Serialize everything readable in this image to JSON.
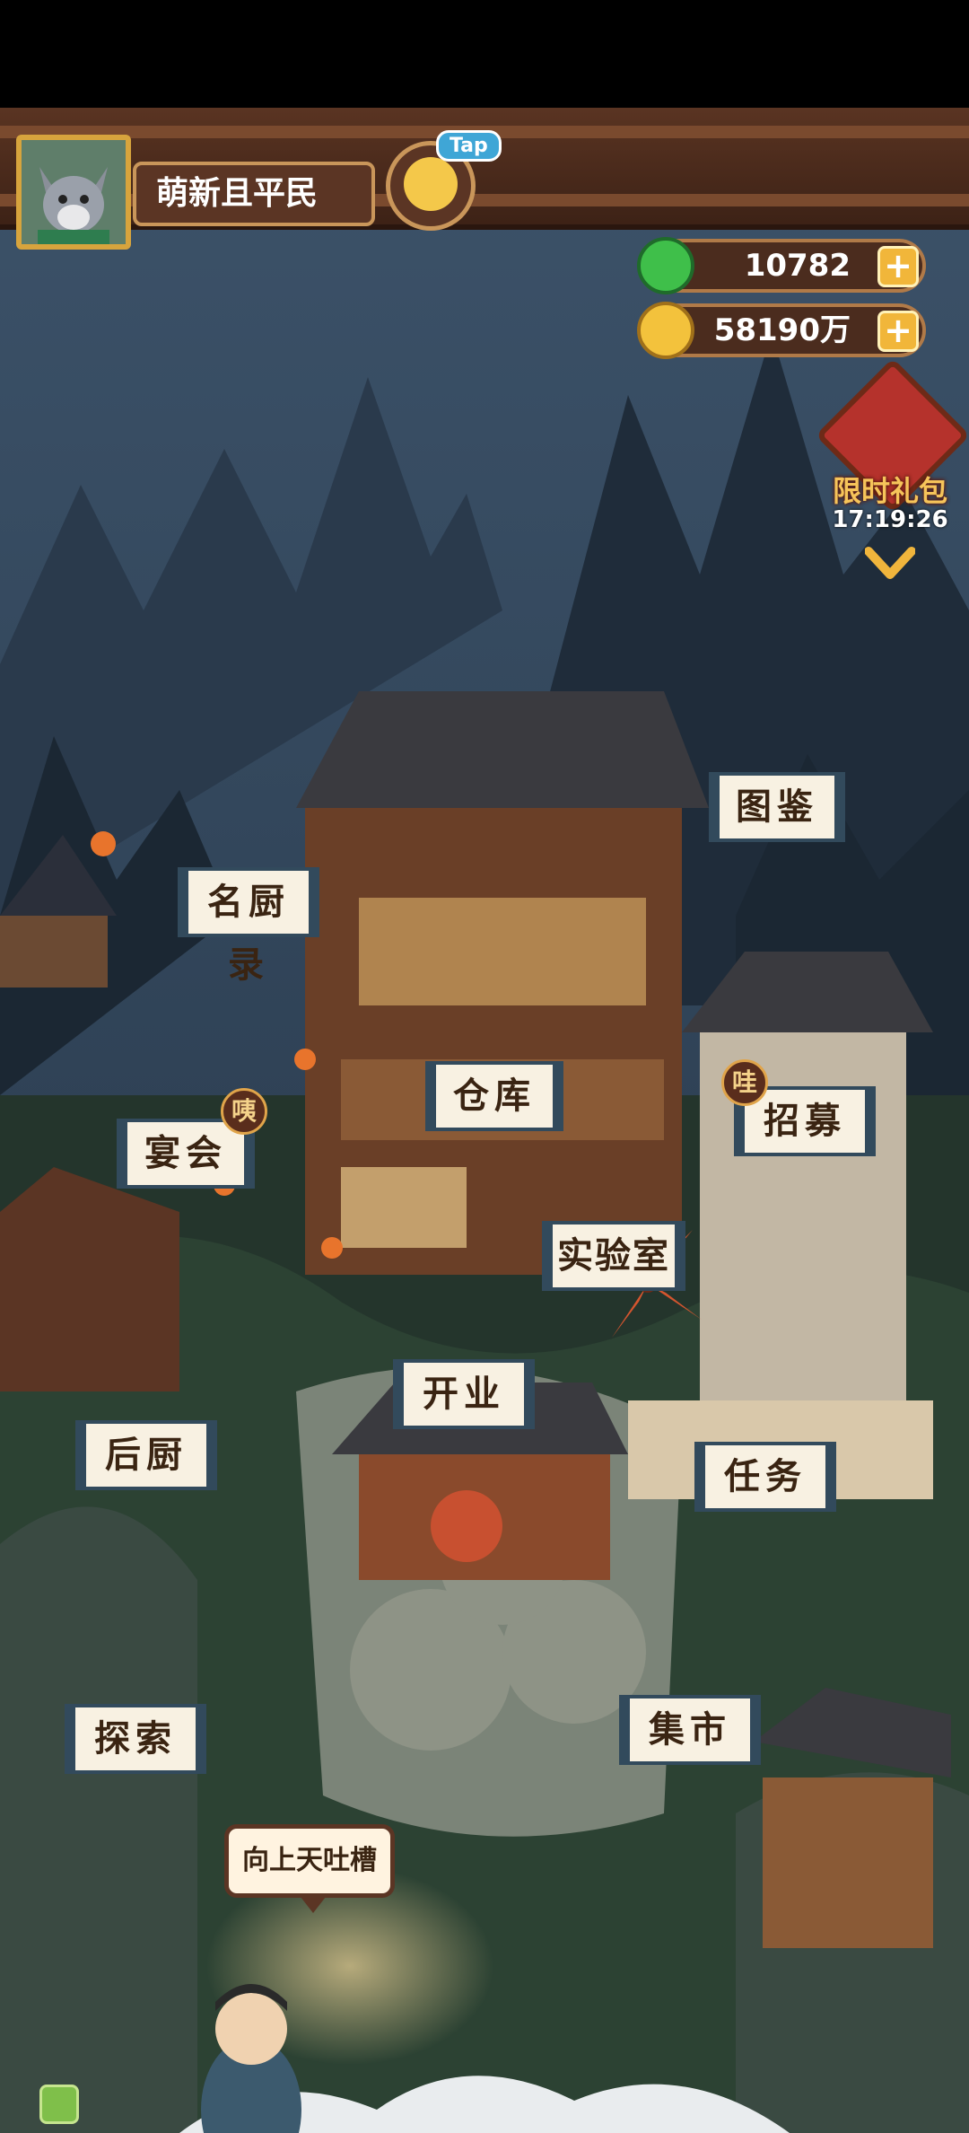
{
  "player": {
    "name": "萌新且平民"
  },
  "tap_button": {
    "label": "Tap"
  },
  "currencies": [
    {
      "name": "jade",
      "value": "10782",
      "icon": "green-jade-icon",
      "color": "#3fbf4a"
    },
    {
      "name": "coins",
      "value": "58190万",
      "icon": "gold-coin-icon",
      "color": "#f3c23c"
    }
  ],
  "gift": {
    "label": "限时礼包",
    "timer": "17:19:26"
  },
  "buildings": {
    "catalog": "图鉴",
    "famous_chefs": "名厨录",
    "warehouse": "仓库",
    "recruit": "招募",
    "recruit_badge": "哇",
    "banquet": "宴会",
    "banquet_badge": "咦",
    "laboratory": "实验室",
    "open_business": "开业",
    "kitchen": "后厨",
    "tasks": "任务",
    "explore": "探索",
    "market": "集市"
  },
  "npc_speech": "向上天吐槽",
  "colors": {
    "sky": "#2f4256",
    "mountain": "#1f2c3a",
    "wood": "#5b3524",
    "sign_border": "#324a5c",
    "accent_gold": "#e0a44a"
  }
}
